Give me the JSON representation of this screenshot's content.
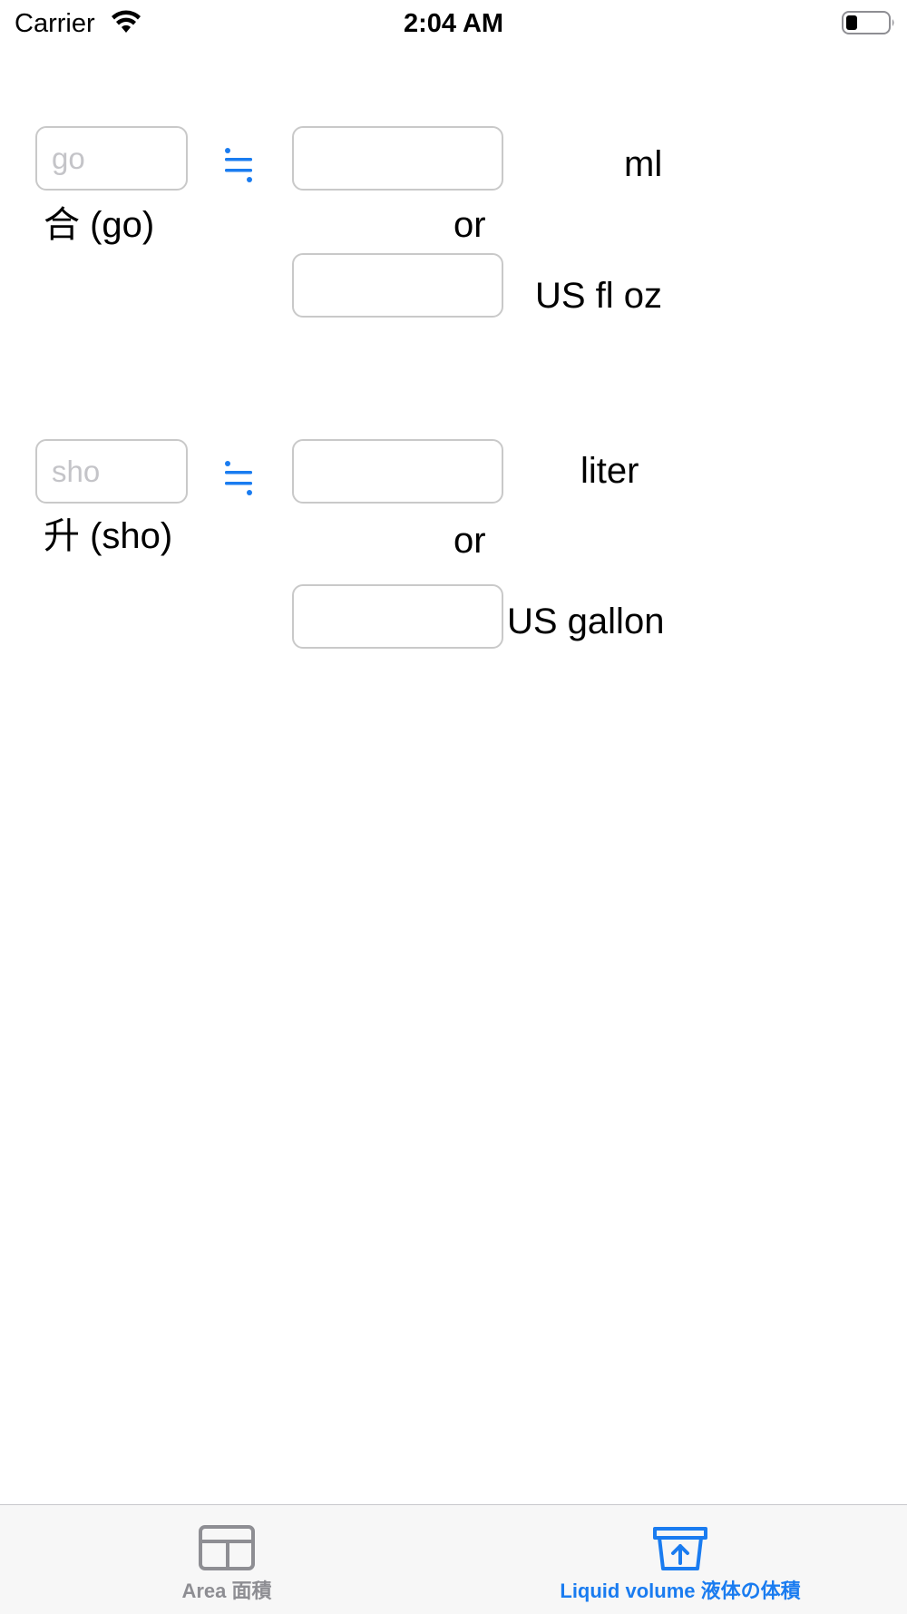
{
  "status_bar": {
    "carrier": "Carrier",
    "time": "2:04 AM"
  },
  "go_section": {
    "input_placeholder": "go",
    "unit_label": "合 (go)",
    "ml_label": "ml",
    "or_label": "or",
    "floz_label": "US fl oz",
    "ml_value": "",
    "floz_value": ""
  },
  "sho_section": {
    "input_placeholder": "sho",
    "unit_label": "升 (sho)",
    "liter_label": "liter",
    "or_label": "or",
    "gallon_label": "US gallon",
    "liter_value": "",
    "gallon_value": ""
  },
  "tab_bar": {
    "tabs": [
      {
        "label": "Area 面積",
        "icon": "area-icon",
        "selected": false
      },
      {
        "label": "Liquid volume 液体の体積",
        "icon": "liquid-volume-icon",
        "selected": true
      }
    ],
    "active_color": "#1a7cf0",
    "inactive_color": "#8e8e93"
  },
  "colors": {
    "accent": "#1a7cf0",
    "field_border": "#c9c9c9",
    "placeholder": "#c4c4c8"
  }
}
